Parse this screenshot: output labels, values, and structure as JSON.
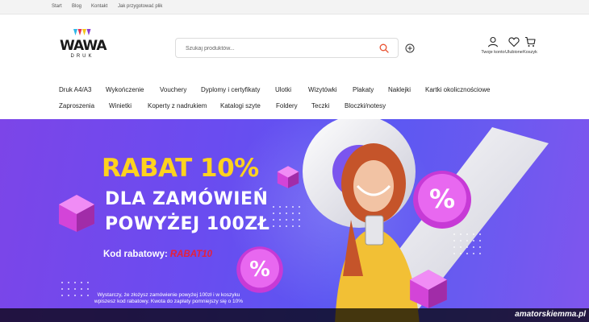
{
  "topbar": {
    "links": [
      "Start",
      "Blog",
      "Kontakt",
      "Jak przygotować plik"
    ]
  },
  "brand": {
    "name": "WAWA",
    "tagline": "DRUK",
    "accent_colors": [
      "#2fb7e8",
      "#e8334f",
      "#f5c518",
      "#8a3fd1"
    ]
  },
  "search": {
    "placeholder": "Szukaj produktów...",
    "icon": "search-icon",
    "icon_color": "#e8502f"
  },
  "account": {
    "my_account_label": "Twoje konto",
    "favorites_label": "Ulubione",
    "cart_label": "Koszyk"
  },
  "nav_row1": [
    "Druk A4/A3",
    "Wykończenie",
    "Vouchery",
    "Dyplomy i certyfikaty",
    "Ulotki",
    "Wizytówki",
    "Plakaty",
    "Naklejki",
    "Kartki okolicznościowe"
  ],
  "nav_row2": [
    "Zaproszenia",
    "Winietki",
    "Koperty z nadrukiem",
    "Katalogi szyte",
    "Foldery",
    "Teczki",
    "Bloczki/notesy"
  ],
  "hero": {
    "headline": "RABAT 10%",
    "line2": "DLA ZAMÓWIEŃ",
    "line3": "POWYŻEJ  100ZŁ",
    "code_label": "Kod rabatowy:",
    "code": "RABAT10",
    "note": "Wystarczy, że złożysz zamówienie powyżej 100zł i w koszyku wpiszesz kod rabatowy. Kwota do zapłaty pomniejszy się o 10%",
    "headline_color": "#ffd21f",
    "code_color": "#e6203a",
    "background": "#6a4cf0"
  },
  "watermark": "amatorskiemma.pl"
}
